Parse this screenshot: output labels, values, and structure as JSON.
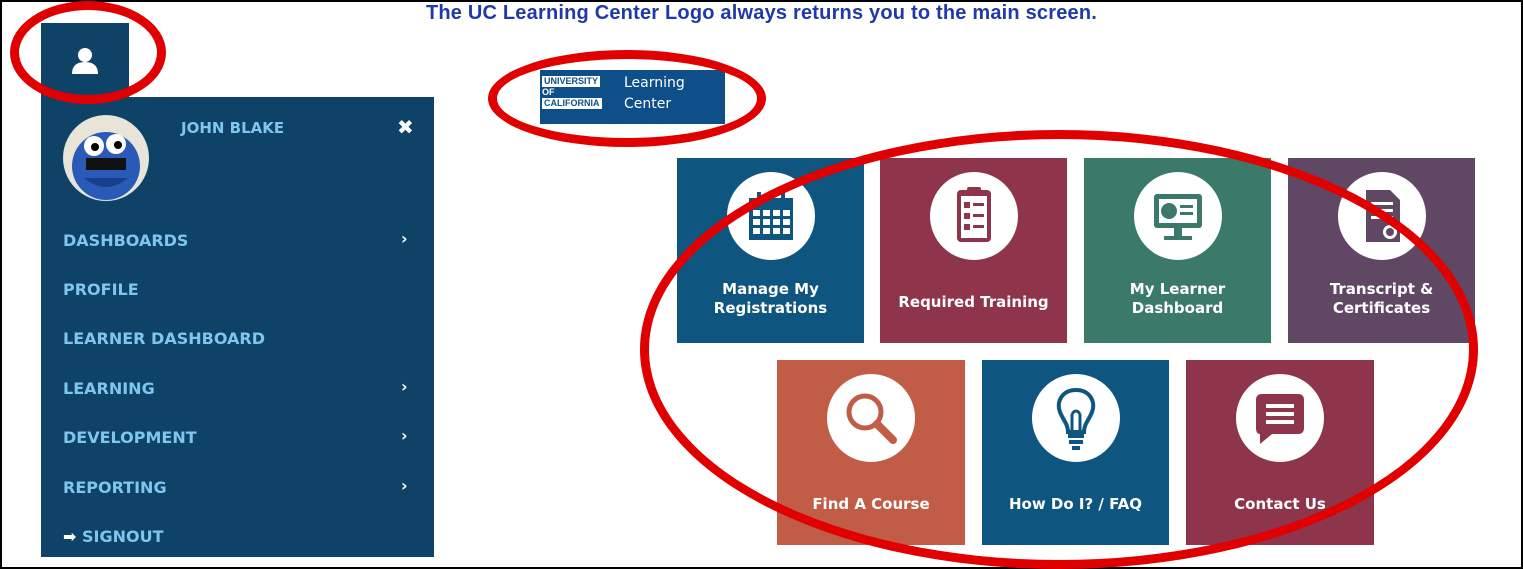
{
  "caption": "The UC Learning Center Logo always returns you to the main screen.",
  "sidebar": {
    "username": "JOHN BLAKE",
    "items": [
      {
        "label": "DASHBOARDS",
        "has_submenu": true
      },
      {
        "label": "PROFILE",
        "has_submenu": false
      },
      {
        "label": "LEARNER DASHBOARD",
        "has_submenu": false
      },
      {
        "label": "LEARNING",
        "has_submenu": true
      },
      {
        "label": "DEVELOPMENT",
        "has_submenu": true
      },
      {
        "label": "REPORTING",
        "has_submenu": true
      }
    ],
    "signout": "SIGNOUT"
  },
  "logo": {
    "line1": "UNIVERSITY",
    "line2": "OF",
    "line3": "CALIFORNIA",
    "title1": "Learning",
    "title2": "Center"
  },
  "tiles": [
    {
      "label": "Manage My Registrations",
      "line1": "Manage My",
      "line2": "Registrations",
      "color": "#0e5580",
      "icon": "calendar-icon"
    },
    {
      "label": "Required Training",
      "line1": "Required Training",
      "line2": "",
      "color": "#8e344b",
      "icon": "clipboard-checklist-icon"
    },
    {
      "label": "My Learner Dashboard",
      "line1": "My Learner",
      "line2": "Dashboard",
      "color": "#3b7a68",
      "icon": "monitor-chart-icon"
    },
    {
      "label": "Transcript & Certificates",
      "line1": "Transcript &",
      "line2": "Certificates",
      "color": "#604864",
      "icon": "certificate-icon"
    },
    {
      "label": "Find A Course",
      "line1": "Find A Course",
      "line2": "",
      "color": "#c15c47",
      "icon": "magnifier-icon"
    },
    {
      "label": "How Do I? / FAQ",
      "line1": "How Do I? / FAQ",
      "line2": "",
      "color": "#0e5580",
      "icon": "lightbulb-icon"
    },
    {
      "label": "Contact Us",
      "line1": "Contact Us",
      "line2": "",
      "color": "#8e344b",
      "icon": "chat-bubble-icon"
    }
  ],
  "colors": {
    "sidebar_bg": "#0e4266",
    "menu_text": "#7fc6ef",
    "caption": "#1f3aa8",
    "annotation": "#e00000"
  }
}
